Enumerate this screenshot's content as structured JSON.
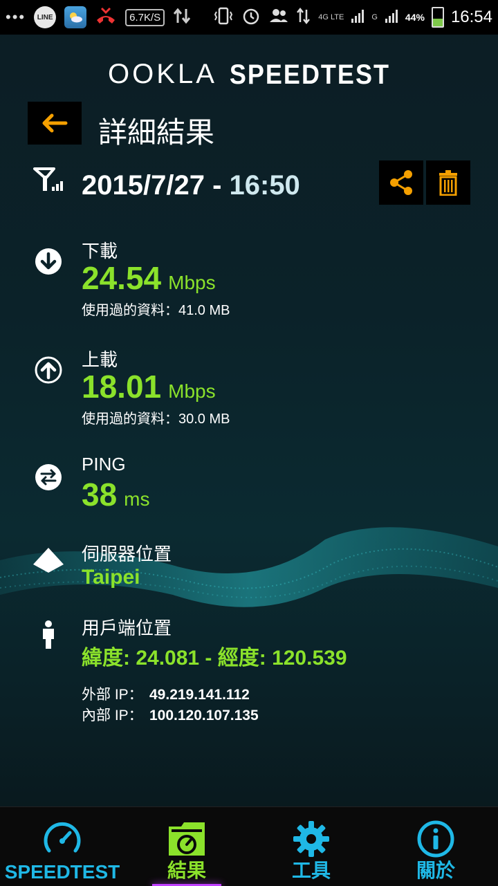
{
  "status_bar": {
    "line_label": "LINE",
    "net_speed": "6.7K/S",
    "net_type": "4G LTE",
    "net_type2": "G",
    "battery_pct": "44%",
    "battery_level": 0.44,
    "time": "16:54"
  },
  "logo": {
    "brand": "OOKLA",
    "product": "SPEEDTEST"
  },
  "header": {
    "title": "詳細結果",
    "back_icon": "arrow-left-icon"
  },
  "result": {
    "date": "2015/7/27",
    "separator": " - ",
    "time": "16:50",
    "share_icon": "share-icon",
    "delete_icon": "trash-icon"
  },
  "download": {
    "label": "下載",
    "value": "24.54",
    "unit": "Mbps",
    "data_used": "使用過的資料：41.0 MB"
  },
  "upload": {
    "label": "上載",
    "value": "18.01",
    "unit": "Mbps",
    "data_used": "使用過的資料：30.0 MB"
  },
  "ping": {
    "label": "PING",
    "value": "38",
    "unit": "ms"
  },
  "server": {
    "label": "伺服器位置",
    "value": "Taipei"
  },
  "client": {
    "label": "用戶端位置",
    "coords": "緯度: 24.081 - 經度: 120.539",
    "external_ip_label": "外部 IP：",
    "external_ip": "49.219.141.112",
    "internal_ip_label": "內部 IP：",
    "internal_ip": "100.120.107.135"
  },
  "nav": {
    "speedtest": "SPEEDTEST",
    "results": "結果",
    "tools": "工具",
    "about": "關於"
  },
  "colors": {
    "accent_green": "#8be22b",
    "nav_blue": "#1fb8e6",
    "action_orange": "#f5a000"
  }
}
